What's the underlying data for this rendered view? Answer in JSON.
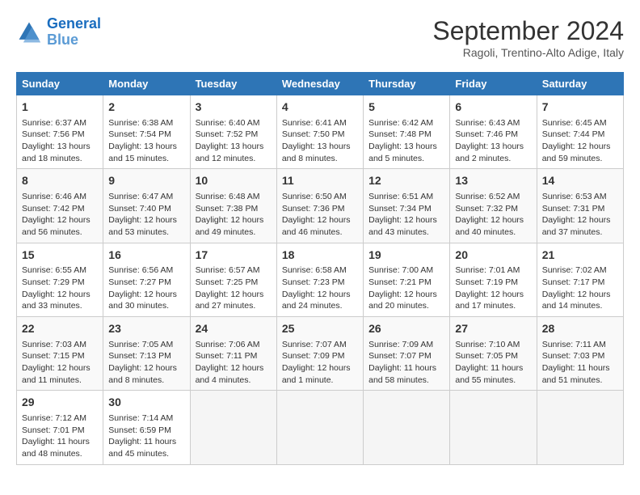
{
  "header": {
    "logo_line1": "General",
    "logo_line2": "Blue",
    "month": "September 2024",
    "location": "Ragoli, Trentino-Alto Adige, Italy"
  },
  "days_of_week": [
    "Sunday",
    "Monday",
    "Tuesday",
    "Wednesday",
    "Thursday",
    "Friday",
    "Saturday"
  ],
  "weeks": [
    [
      {
        "day": "1",
        "info": "Sunrise: 6:37 AM\nSunset: 7:56 PM\nDaylight: 13 hours\nand 18 minutes."
      },
      {
        "day": "2",
        "info": "Sunrise: 6:38 AM\nSunset: 7:54 PM\nDaylight: 13 hours\nand 15 minutes."
      },
      {
        "day": "3",
        "info": "Sunrise: 6:40 AM\nSunset: 7:52 PM\nDaylight: 13 hours\nand 12 minutes."
      },
      {
        "day": "4",
        "info": "Sunrise: 6:41 AM\nSunset: 7:50 PM\nDaylight: 13 hours\nand 8 minutes."
      },
      {
        "day": "5",
        "info": "Sunrise: 6:42 AM\nSunset: 7:48 PM\nDaylight: 13 hours\nand 5 minutes."
      },
      {
        "day": "6",
        "info": "Sunrise: 6:43 AM\nSunset: 7:46 PM\nDaylight: 13 hours\nand 2 minutes."
      },
      {
        "day": "7",
        "info": "Sunrise: 6:45 AM\nSunset: 7:44 PM\nDaylight: 12 hours\nand 59 minutes."
      }
    ],
    [
      {
        "day": "8",
        "info": "Sunrise: 6:46 AM\nSunset: 7:42 PM\nDaylight: 12 hours\nand 56 minutes."
      },
      {
        "day": "9",
        "info": "Sunrise: 6:47 AM\nSunset: 7:40 PM\nDaylight: 12 hours\nand 53 minutes."
      },
      {
        "day": "10",
        "info": "Sunrise: 6:48 AM\nSunset: 7:38 PM\nDaylight: 12 hours\nand 49 minutes."
      },
      {
        "day": "11",
        "info": "Sunrise: 6:50 AM\nSunset: 7:36 PM\nDaylight: 12 hours\nand 46 minutes."
      },
      {
        "day": "12",
        "info": "Sunrise: 6:51 AM\nSunset: 7:34 PM\nDaylight: 12 hours\nand 43 minutes."
      },
      {
        "day": "13",
        "info": "Sunrise: 6:52 AM\nSunset: 7:32 PM\nDaylight: 12 hours\nand 40 minutes."
      },
      {
        "day": "14",
        "info": "Sunrise: 6:53 AM\nSunset: 7:31 PM\nDaylight: 12 hours\nand 37 minutes."
      }
    ],
    [
      {
        "day": "15",
        "info": "Sunrise: 6:55 AM\nSunset: 7:29 PM\nDaylight: 12 hours\nand 33 minutes."
      },
      {
        "day": "16",
        "info": "Sunrise: 6:56 AM\nSunset: 7:27 PM\nDaylight: 12 hours\nand 30 minutes."
      },
      {
        "day": "17",
        "info": "Sunrise: 6:57 AM\nSunset: 7:25 PM\nDaylight: 12 hours\nand 27 minutes."
      },
      {
        "day": "18",
        "info": "Sunrise: 6:58 AM\nSunset: 7:23 PM\nDaylight: 12 hours\nand 24 minutes."
      },
      {
        "day": "19",
        "info": "Sunrise: 7:00 AM\nSunset: 7:21 PM\nDaylight: 12 hours\nand 20 minutes."
      },
      {
        "day": "20",
        "info": "Sunrise: 7:01 AM\nSunset: 7:19 PM\nDaylight: 12 hours\nand 17 minutes."
      },
      {
        "day": "21",
        "info": "Sunrise: 7:02 AM\nSunset: 7:17 PM\nDaylight: 12 hours\nand 14 minutes."
      }
    ],
    [
      {
        "day": "22",
        "info": "Sunrise: 7:03 AM\nSunset: 7:15 PM\nDaylight: 12 hours\nand 11 minutes."
      },
      {
        "day": "23",
        "info": "Sunrise: 7:05 AM\nSunset: 7:13 PM\nDaylight: 12 hours\nand 8 minutes."
      },
      {
        "day": "24",
        "info": "Sunrise: 7:06 AM\nSunset: 7:11 PM\nDaylight: 12 hours\nand 4 minutes."
      },
      {
        "day": "25",
        "info": "Sunrise: 7:07 AM\nSunset: 7:09 PM\nDaylight: 12 hours\nand 1 minute."
      },
      {
        "day": "26",
        "info": "Sunrise: 7:09 AM\nSunset: 7:07 PM\nDaylight: 11 hours\nand 58 minutes."
      },
      {
        "day": "27",
        "info": "Sunrise: 7:10 AM\nSunset: 7:05 PM\nDaylight: 11 hours\nand 55 minutes."
      },
      {
        "day": "28",
        "info": "Sunrise: 7:11 AM\nSunset: 7:03 PM\nDaylight: 11 hours\nand 51 minutes."
      }
    ],
    [
      {
        "day": "29",
        "info": "Sunrise: 7:12 AM\nSunset: 7:01 PM\nDaylight: 11 hours\nand 48 minutes."
      },
      {
        "day": "30",
        "info": "Sunrise: 7:14 AM\nSunset: 6:59 PM\nDaylight: 11 hours\nand 45 minutes."
      },
      {
        "day": "",
        "info": ""
      },
      {
        "day": "",
        "info": ""
      },
      {
        "day": "",
        "info": ""
      },
      {
        "day": "",
        "info": ""
      },
      {
        "day": "",
        "info": ""
      }
    ]
  ]
}
